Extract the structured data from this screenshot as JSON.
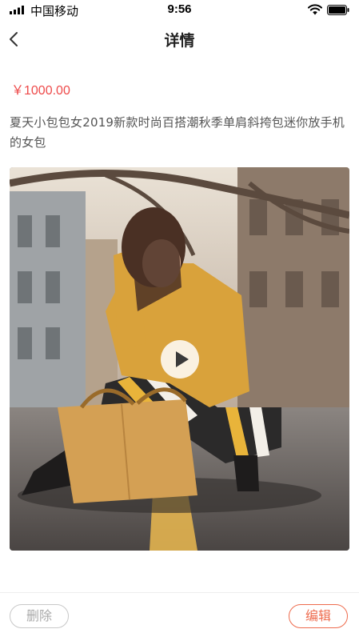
{
  "status_bar": {
    "carrier": "中国移动",
    "time": "9:56"
  },
  "nav": {
    "title": "详情",
    "back_icon": "chevron-left-icon"
  },
  "product": {
    "price": "￥1000.00",
    "title": "夏天小包包女2019新款时尚百搭潮秋季单肩斜挎包迷你放手机的女包"
  },
  "media": {
    "play_icon": "play-icon"
  },
  "actions": {
    "delete_label": "删除",
    "edit_label": "编辑"
  },
  "colors": {
    "price": "#ee4a4a",
    "accent": "#ee6b4d",
    "disabled": "#aaaaaa"
  }
}
